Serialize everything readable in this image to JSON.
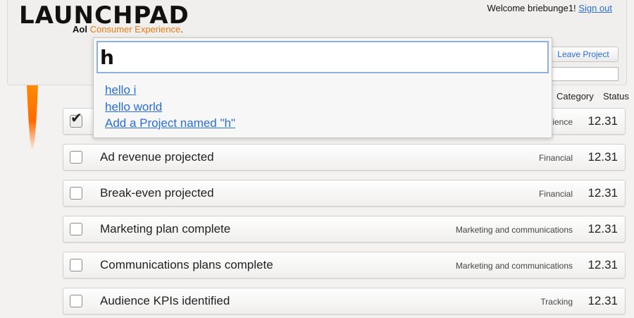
{
  "header": {
    "logo": "LAUNCHPAD",
    "tagline_brand": "Aol",
    "tagline_rest": "Consumer Experience",
    "tagline_dot": ".",
    "welcome_text": "Welcome briebunge1!",
    "sign_out": "Sign out",
    "leave_project": "Leave Project"
  },
  "search": {
    "value": "h",
    "suggestions": [
      "hello i",
      "hello world",
      "Add a Project named \"h\""
    ]
  },
  "columns": {
    "category": "Category",
    "status": "Status"
  },
  "rows": [
    {
      "title": "",
      "category": "ience",
      "status": "12.31",
      "checked": true
    },
    {
      "title": "Ad revenue projected",
      "category": "Financial",
      "status": "12.31",
      "checked": false
    },
    {
      "title": "Break-even projected",
      "category": "Financial",
      "status": "12.31",
      "checked": false
    },
    {
      "title": "Marketing plan complete",
      "category": "Marketing and communications",
      "status": "12.31",
      "checked": false
    },
    {
      "title": "Communications plans complete",
      "category": "Marketing and communications",
      "status": "12.31",
      "checked": false
    },
    {
      "title": "Audience KPIs identified",
      "category": "Tracking",
      "status": "12.31",
      "checked": false
    }
  ],
  "colors": {
    "link": "#2a6fd1",
    "brand_orange": "#e87a14",
    "focus_border": "#8fb0e0"
  },
  "icons": {
    "check": "check-icon",
    "rocket": "rocket-icon"
  }
}
